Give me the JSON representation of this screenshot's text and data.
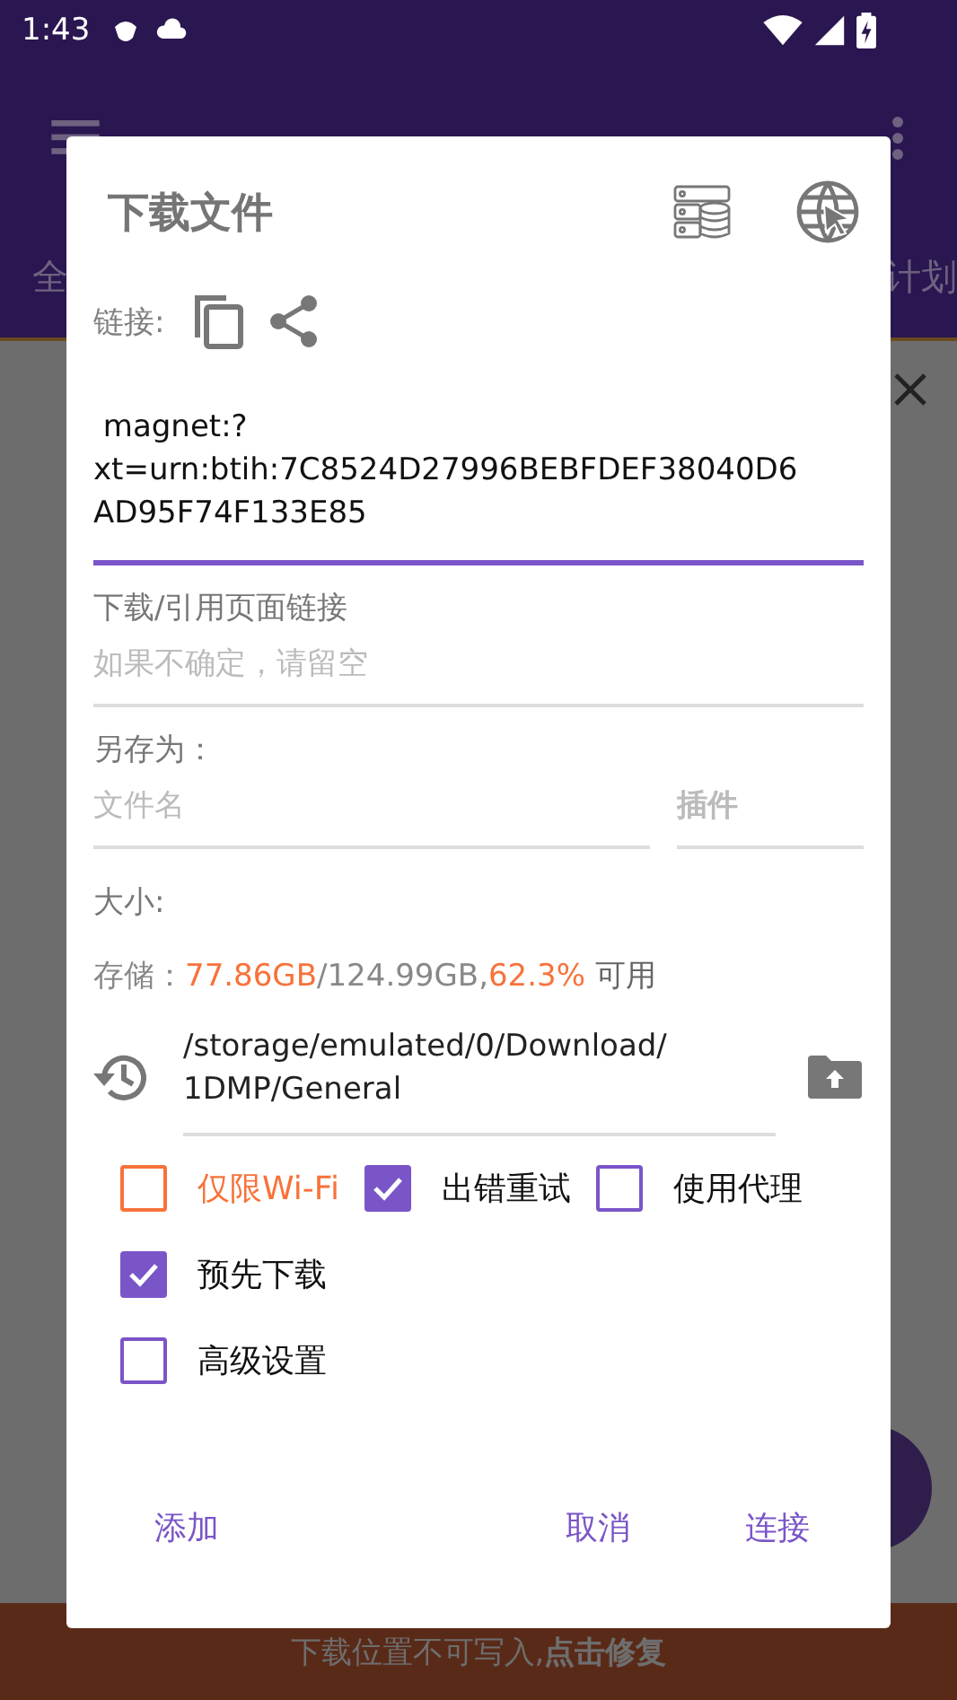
{
  "status_bar": {
    "time": "1:43"
  },
  "background": {
    "tabs": [
      {
        "label": "全"
      },
      {
        "label": "计划"
      }
    ],
    "banner": "下载位置不可写入,**点击修复**"
  },
  "dialog": {
    "title": "下载文件",
    "link_label": "链接:",
    "url": " magnet:?\nxt=urn:btih:7C8524D27996BEBFDEF38040D6\nAD95F74F133E85",
    "referrer": {
      "label": "下载/引用页面链接",
      "placeholder": "如果不确定，请留空"
    },
    "save_as": {
      "label": "另存为：",
      "filename_placeholder": "文件名",
      "plugin_placeholder": "插件"
    },
    "size_label": "大小:",
    "storage": {
      "label": "存储：",
      "used": "77.86GB",
      "total": "/124.99GB,",
      "percent": "62.3%",
      "suffix": "可用"
    },
    "path": "/storage/emulated/0/Download/\n1DMP/General",
    "option_rows": [
      [
        {
          "label": "仅限Wi-Fi",
          "checked": false,
          "warning": true
        },
        {
          "label": "出错重试",
          "checked": true,
          "warning": false
        },
        {
          "label": "使用代理",
          "checked": false,
          "warning": false
        }
      ],
      [
        {
          "label": "预先下载",
          "checked": true,
          "warning": false
        }
      ],
      [
        {
          "label": "高级设置",
          "checked": false,
          "warning": false
        }
      ]
    ],
    "buttons_left": [
      "添加"
    ],
    "buttons_right": [
      "取消",
      "连接"
    ]
  }
}
